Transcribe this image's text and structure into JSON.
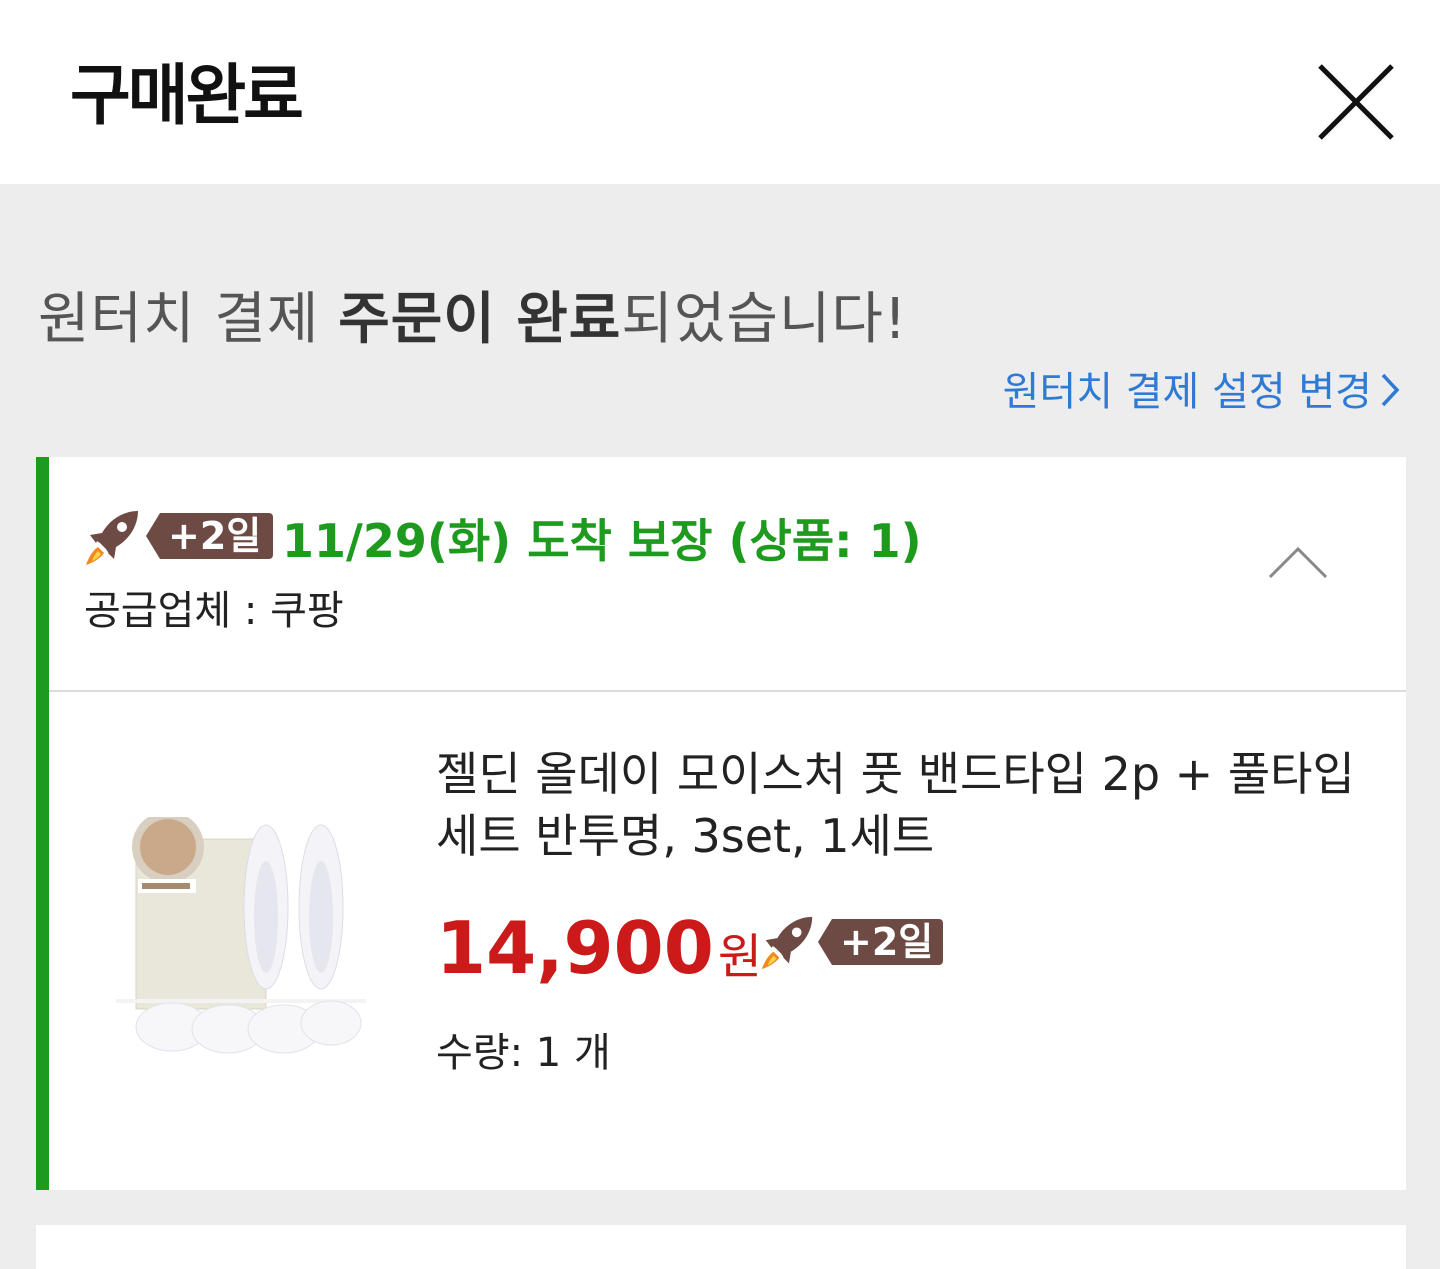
{
  "header": {
    "title": "구매완료"
  },
  "message": {
    "prefix": "원터치 결제 ",
    "highlight": "주문이 완료",
    "suffix": "되었습니다!",
    "settings_link": "원터치 결제 설정 변경"
  },
  "delivery": {
    "badge": "+2일",
    "guarantee_text": "11/29(화) 도착 보장 (상품: 1)",
    "supplier": "공급업체 : 쿠팡"
  },
  "product": {
    "name": "젤딘 올데이 모이스처 풋 밴드타입 2p + 풀타입 세트 반투명, 3set, 1세트",
    "price": "14,900",
    "price_unit": "원",
    "badge": "+2일",
    "quantity": "수량: 1 개"
  },
  "colors": {
    "accent_green": "#1e9b1e",
    "price_red": "#cc1a1a",
    "link_blue": "#2e7bd6",
    "badge_brown": "#6d4a44"
  },
  "icons": {
    "close": "close-icon",
    "collapse": "chevron-up-icon",
    "link_arrow": "chevron-right-icon",
    "rocket": "rocket-icon"
  }
}
